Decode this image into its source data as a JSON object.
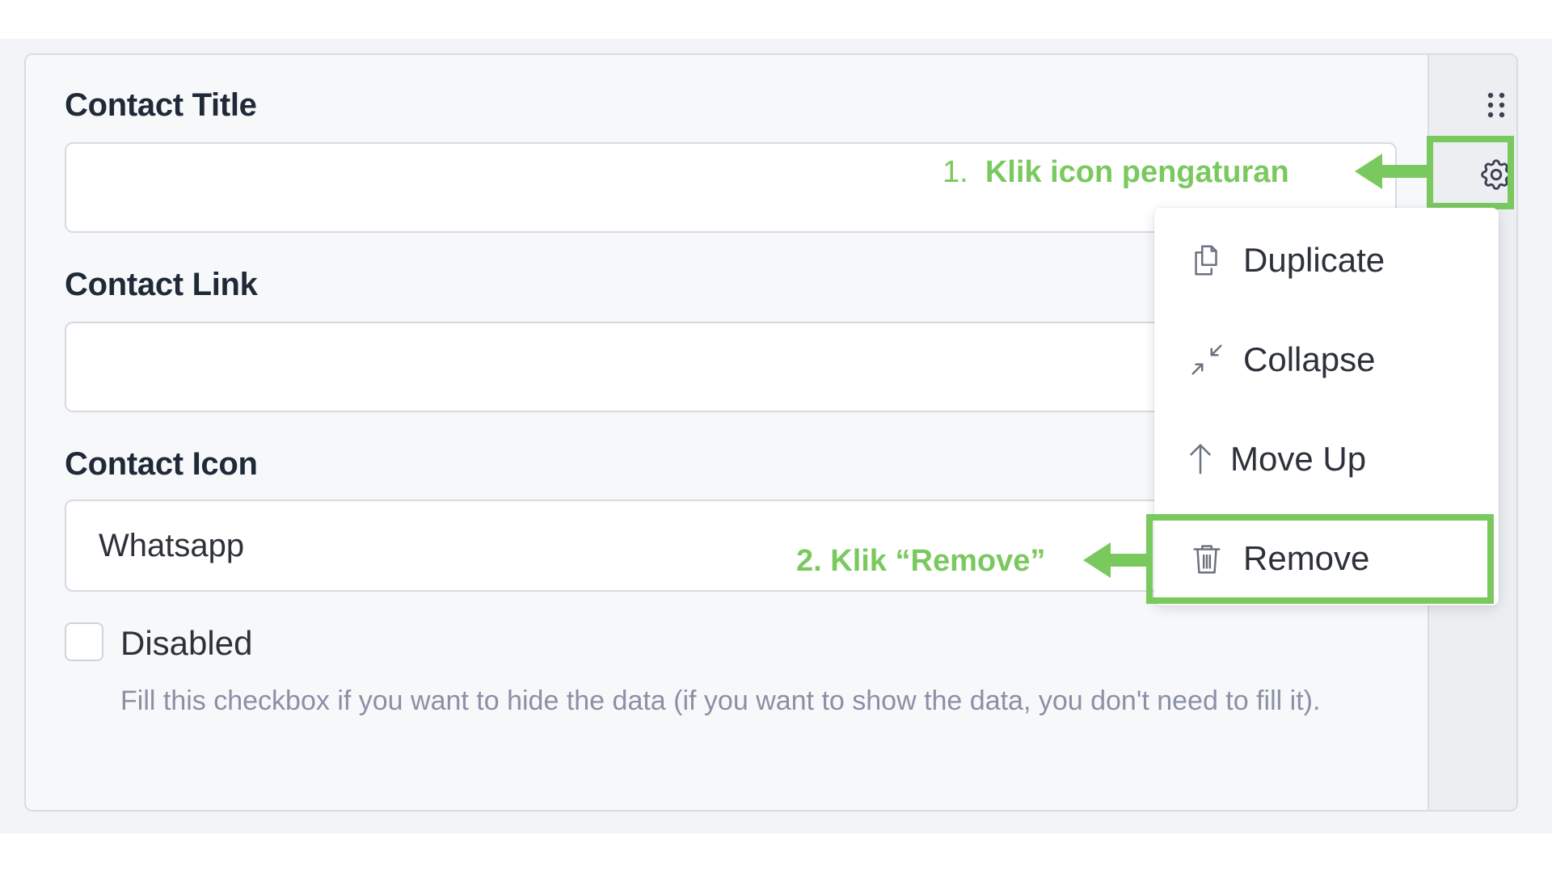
{
  "form": {
    "contact_title": {
      "label": "Contact Title",
      "value": "",
      "placeholder": ""
    },
    "contact_link": {
      "label": "Contact Link",
      "value": "",
      "placeholder": ""
    },
    "contact_icon": {
      "label": "Contact Icon",
      "selected": "Whatsapp"
    },
    "disabled": {
      "label": "Disabled",
      "checked": false,
      "help": "Fill this checkbox if you want to hide the data (if you want to show the data, you don't need to fill it)."
    }
  },
  "toolbar": {
    "drag_icon": "drag-dots-icon",
    "settings_icon": "gear-icon"
  },
  "menu": {
    "items": [
      {
        "label": "Duplicate",
        "icon": "duplicate-icon"
      },
      {
        "label": "Collapse",
        "icon": "collapse-icon"
      },
      {
        "label": "Move Up",
        "icon": "arrow-up-icon"
      },
      {
        "label": "Remove",
        "icon": "trash-icon"
      }
    ]
  },
  "annotations": {
    "step1_number": "1.",
    "step1_text": "Klik icon pengaturan",
    "step2_text": "2. Klik “Remove”",
    "highlight_color": "#7ac95f"
  }
}
